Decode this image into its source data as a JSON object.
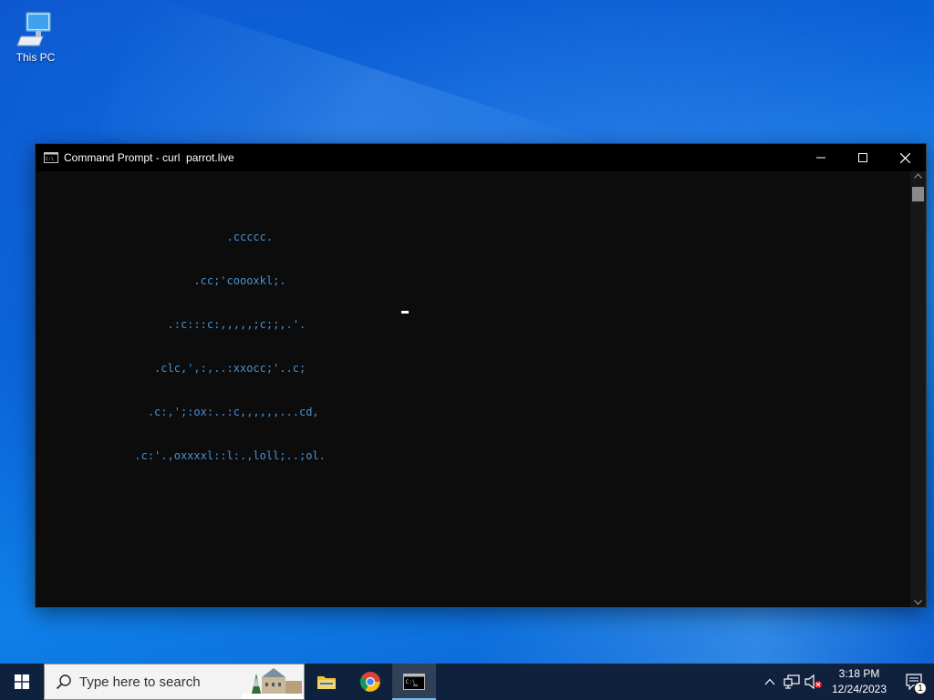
{
  "desktop": {
    "icons": [
      {
        "label": "This PC",
        "icon": "this-pc-icon"
      }
    ]
  },
  "window": {
    "title": "Command Prompt - curl  parrot.live",
    "icon": "cmd-icon",
    "controls": {
      "minimize": "minimize-icon",
      "maximize": "maximize-icon",
      "close": "close-icon"
    }
  },
  "console": {
    "lines": [
      "                             .ccccc.",
      "                        .cc;'coooxkl;.",
      "                    .:c:::c:,,,,,;c;;,.'.",
      "                  .clc,',:,..:xxocc;'..c;",
      "                 .c:,';:ox:..:c,,,,,,...cd,",
      "               .c:'.,oxxxxl::l:.,loll;..;ol."
    ]
  },
  "taskbar": {
    "search_placeholder": "Type here to search",
    "apps": [
      {
        "name": "file-explorer",
        "icon": "folder-icon"
      },
      {
        "name": "chrome",
        "icon": "chrome-icon"
      },
      {
        "name": "command-prompt",
        "icon": "cmd-icon",
        "active": true
      }
    ],
    "tray": {
      "time": "3:18 PM",
      "date": "12/24/2023",
      "notification_count": "1"
    }
  },
  "colors": {
    "console_text": "#4b8fd4",
    "console_bg": "#0c0c0c",
    "taskbar_bg": "#101e34",
    "accent": "#76b9ed"
  }
}
